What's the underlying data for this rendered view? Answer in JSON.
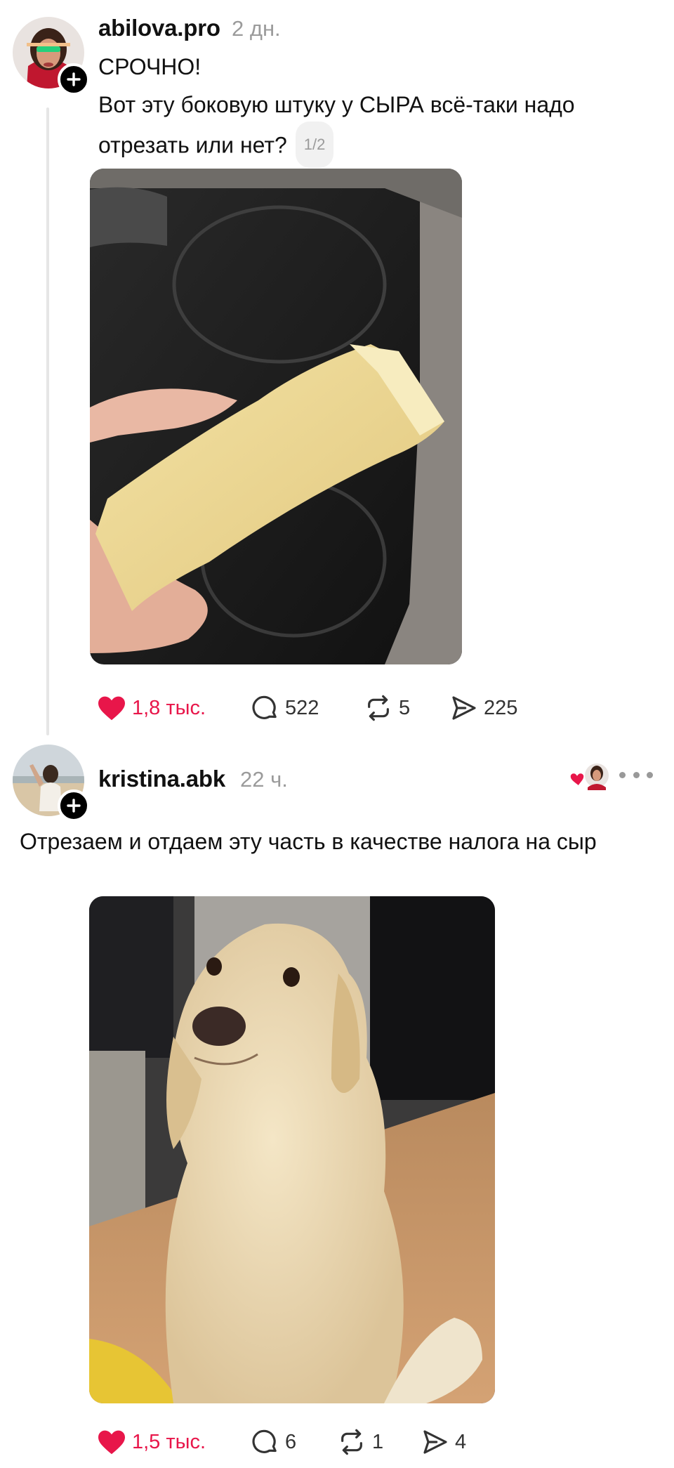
{
  "post1": {
    "username": "abilova.pro",
    "time": "2 дн.",
    "line1": "СРОЧНО!",
    "line2": "Вот эту боковую штуку у СЫРА всё-таки надо",
    "line3": "отрезать или нет?",
    "counter": "1/2",
    "likes": "1,8 тыс.",
    "comments": "522",
    "reposts": "5",
    "shares": "225"
  },
  "post2": {
    "username": "kristina.abk",
    "time": "22 ч.",
    "text": "Отрезаем и отдаем эту часть в качестве налога на сыр",
    "likes": "1,5 тыс.",
    "comments": "6",
    "reposts": "1",
    "shares": "4"
  },
  "colors": {
    "like": "#e8164a",
    "muted": "#9b9b9b",
    "text": "#111111"
  },
  "icons": [
    "plus-icon",
    "heart-icon",
    "comment-icon",
    "repost-icon",
    "share-icon",
    "more-icon"
  ]
}
